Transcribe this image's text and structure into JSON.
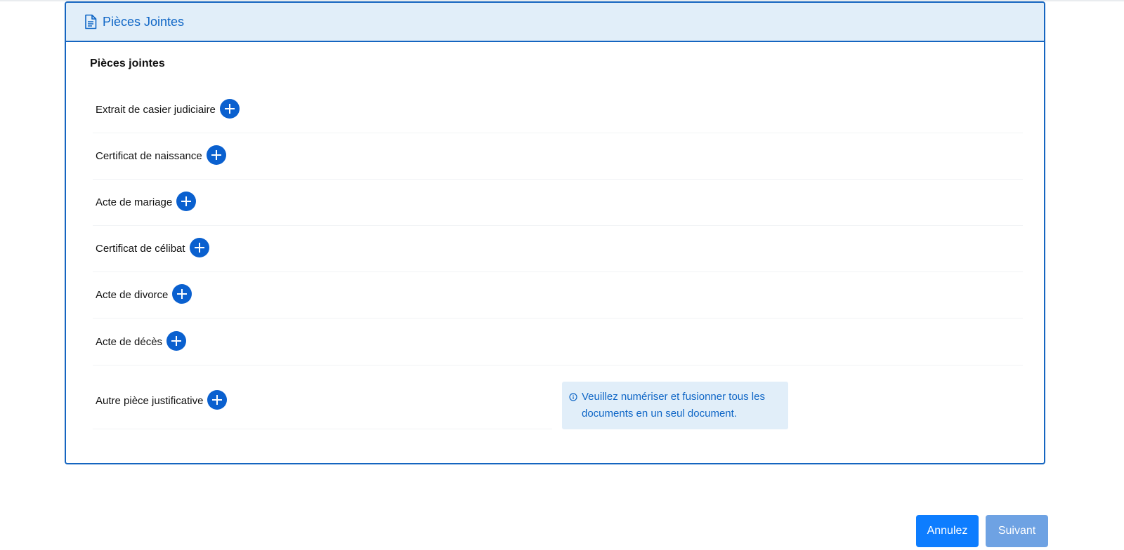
{
  "card": {
    "header_title": "Pièces Jointes",
    "section_title": "Pièces jointes"
  },
  "attachments": [
    {
      "label": "Extrait de casier judiciaire"
    },
    {
      "label": "Certificat de naissance"
    },
    {
      "label": "Acte de mariage"
    },
    {
      "label": "Certificat de célibat"
    },
    {
      "label": "Acte de divorce"
    },
    {
      "label": "Acte de décès"
    },
    {
      "label": "Autre pièce justificative"
    }
  ],
  "info": {
    "line1": "Veuillez numériser et fusionner tous les",
    "line2": "documents en un seul document."
  },
  "buttons": {
    "cancel": "Annulez",
    "next": "Suivant"
  },
  "colors": {
    "accent": "#0f66c6",
    "border": "#1565c0",
    "header_bg": "#e1eef9",
    "primary_button": "#0d7dff",
    "disabled_button": "#6ea2e3"
  },
  "icons": {
    "header": "document-icon",
    "add": "plus-circle-icon",
    "info": "info-icon"
  }
}
